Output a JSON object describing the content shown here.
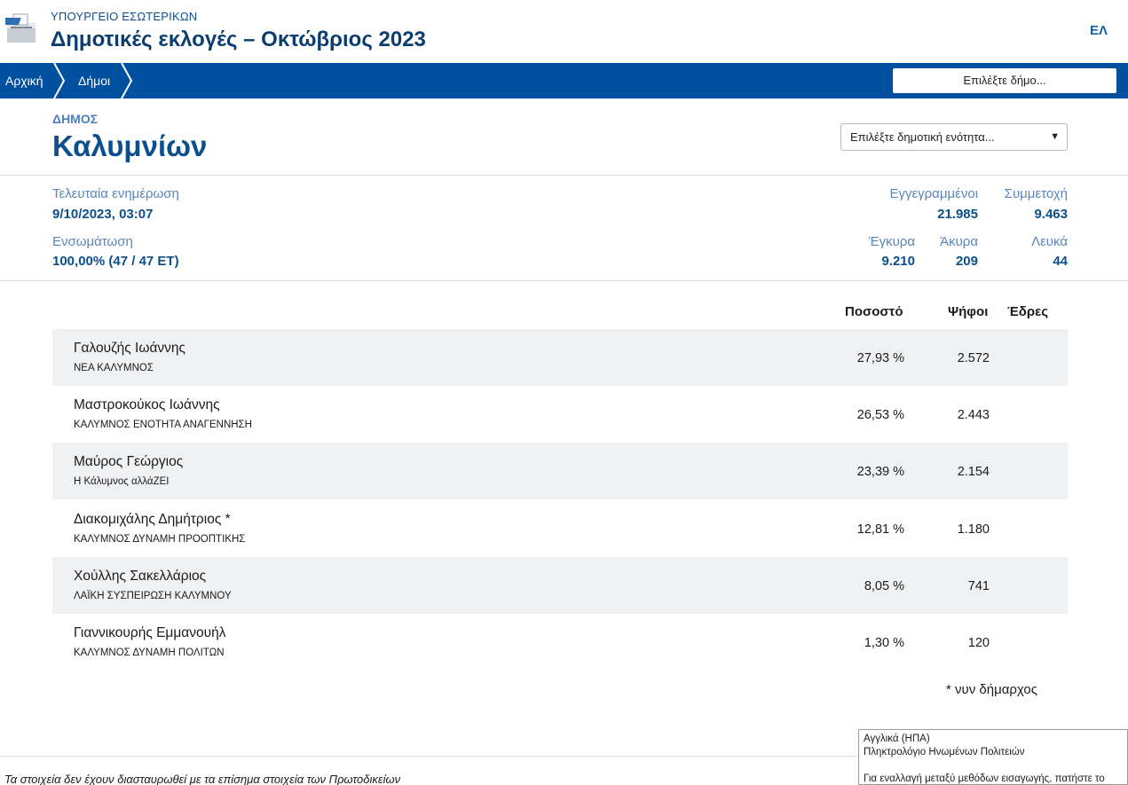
{
  "header": {
    "ministry": "ΥΠΟΥΡΓΕΙΟ ΕΣΩΤΕΡΙΚΩΝ",
    "title": "Δημοτικές εκλογές – Οκτώβριος 2023",
    "language": "ΕΛ",
    "logo_icon": "ballot-box-icon"
  },
  "nav": {
    "breadcrumbs": [
      "Αρχική",
      "Δήμοι"
    ],
    "select_municipality": "Επιλέξτε δήμο..."
  },
  "municipality": {
    "label": "ΔΗΜΟΣ",
    "name": "Καλυμνίων",
    "unit_select": "Επιλέξτε δημοτική ενότητα...",
    "unit_select_icon": "chevron-down-icon"
  },
  "stats": {
    "last_update_label": "Τελευταία ενημέρωση",
    "last_update_value": "9/10/2023, 03:07",
    "integration_label": "Ενσωμάτωση",
    "integration_value": "100,00% (47 / 47 ΕΤ)",
    "registered_label": "Εγγεγραμμένοι",
    "registered_value": "21.985",
    "turnout_label": "Συμμετοχή",
    "turnout_value": "9.463",
    "valid_label": "Έγκυρα",
    "valid_value": "9.210",
    "invalid_label": "Άκυρα",
    "invalid_value": "209",
    "blank_label": "Λευκά",
    "blank_value": "44"
  },
  "table": {
    "headers": {
      "percent": "Ποσοστό",
      "votes": "Ψήφοι",
      "seats": "Έδρες"
    },
    "rows": [
      {
        "name": "Γαλουζής Ιωάννης",
        "party": "ΝΕΑ ΚΑΛΥΜΝΟΣ",
        "percent": "27,93 %",
        "votes": "2.572"
      },
      {
        "name": "Μαστροκούκος Ιωάννης",
        "party": "ΚΑΛΥΜΝΟΣ ΕΝΟΤΗΤΑ ΑΝΑΓΕΝΝΗΣΗ",
        "percent": "26,53 %",
        "votes": "2.443"
      },
      {
        "name": "Μαύρος Γεώργιος",
        "party": "Η Κάλυμνος αλλάΖΕΙ",
        "percent": "23,39 %",
        "votes": "2.154"
      },
      {
        "name": "Διακομιχάλης Δημήτριος *",
        "party": "ΚΑΛΥΜΝΟΣ ΔΥΝΑΜΗ ΠΡΟΟΠΤΙΚΗΣ",
        "percent": "12,81 %",
        "votes": "1.180"
      },
      {
        "name": "Χούλλης Σακελλάριος",
        "party": "ΛΑΪΚΗ ΣΥΣΠΕΙΡΩΣΗ ΚΑΛΥΜΝΟΥ",
        "percent": "8,05 %",
        "votes": "741"
      },
      {
        "name": "Γιαννικουρής Εμμανουήλ",
        "party": "ΚΑΛΥΜΝΟΣ ΔΥΝΑΜΗ ΠΟΛΙΤΩΝ",
        "percent": "1,30 %",
        "votes": "120"
      }
    ],
    "footnote": "* νυν δήμαρχος"
  },
  "footer": {
    "disclaimer": "Τα στοιχεία δεν έχουν διασταυρωθεί με τα επίσημα στοιχεία των Πρωτοδικείων"
  },
  "ime_popup": {
    "line1": "Αγγλικά (ΗΠΑ)",
    "line2": "Πληκτρολόγιο Ηνωμένων Πολιτειών",
    "line3": "Για εναλλαγή μεταξύ μεθόδων εισαγωγής, πατήστε το"
  }
}
